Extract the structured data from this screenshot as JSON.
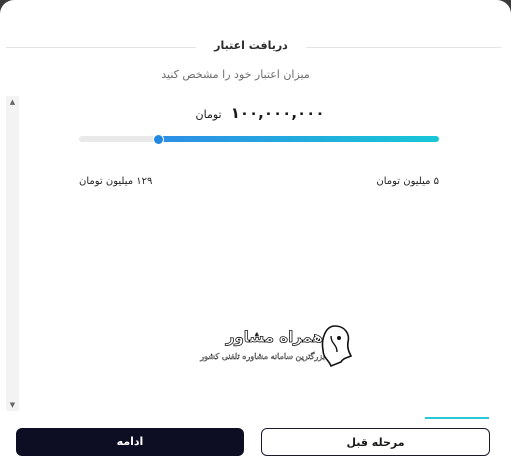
{
  "dialog": {
    "title": "دریافت اعتبار",
    "subtitle": "میزان اعتبار خود را مشخص کنید"
  },
  "credit": {
    "amount": "۱۰۰,۰۰۰,۰۰۰",
    "unit": "تومان",
    "slider_fraction": 0.22,
    "max_label": "۱۲۹ میلیون تومان",
    "min_label": "۵ میلیون تومان"
  },
  "watermark": {
    "title": "همراه مشاور",
    "subtitle": "بزرگترین سامانه مشاوره تلفنی کشور"
  },
  "buttons": {
    "continue_label": "ادامه",
    "previous_label": "مرحله قبل"
  },
  "scrollbar": {
    "up_icon": "▲",
    "down_icon": "▼"
  }
}
